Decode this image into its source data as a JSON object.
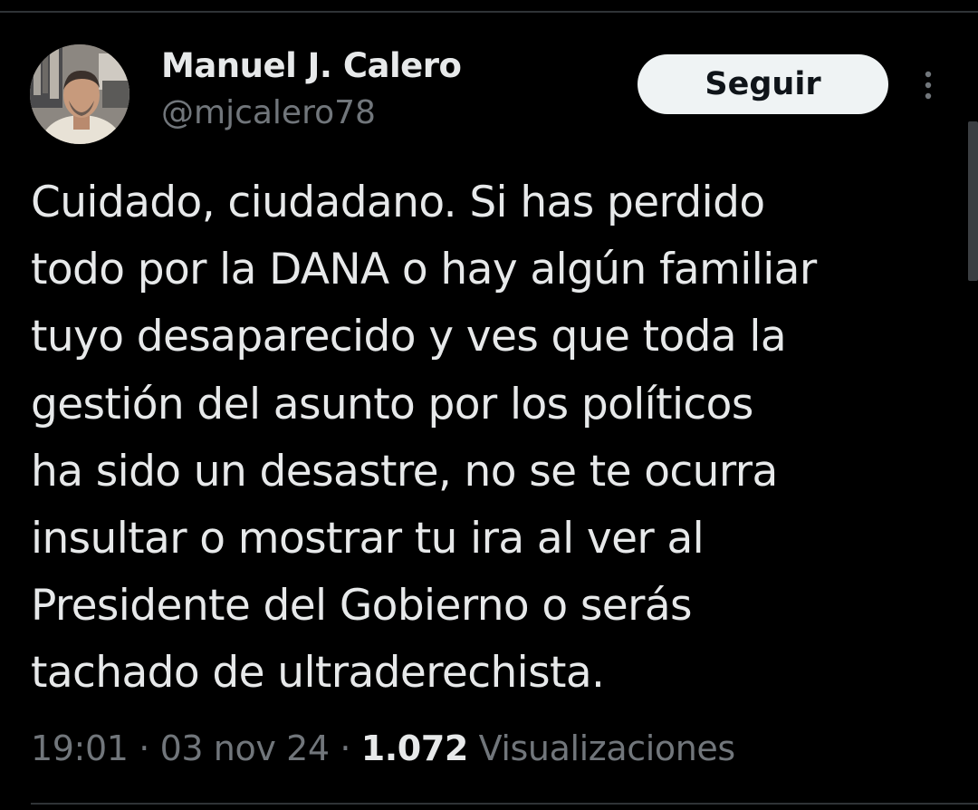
{
  "author": {
    "display_name": "Manuel J. Calero",
    "handle": "@mjcalero78",
    "avatar_icon": "profile-photo"
  },
  "follow_button": {
    "label": "Seguir"
  },
  "more_menu": {
    "icon": "more-vertical-icon"
  },
  "tweet": {
    "lines": [
      "Cuidado, ciudadano. Si has perdido",
      "todo por la DANA o hay algún familiar",
      "tuyo desaparecido y ves que toda la",
      "gestión del asunto por los políticos",
      "ha sido un desastre, no se te ocurra",
      "insultar o mostrar tu ira al ver al",
      "Presidente del Gobierno o serás",
      "tachado de ultraderechista."
    ]
  },
  "meta": {
    "time": "19:01",
    "separator": " · ",
    "date": "03 nov 24",
    "views_count": "1.072",
    "views_label": "Visualizaciones"
  },
  "colors": {
    "background": "#000000",
    "text_primary": "#e7e9ea",
    "text_secondary": "#71767b",
    "button_bg": "#eff3f4",
    "button_text": "#0f1419",
    "divider": "#2f3336"
  }
}
